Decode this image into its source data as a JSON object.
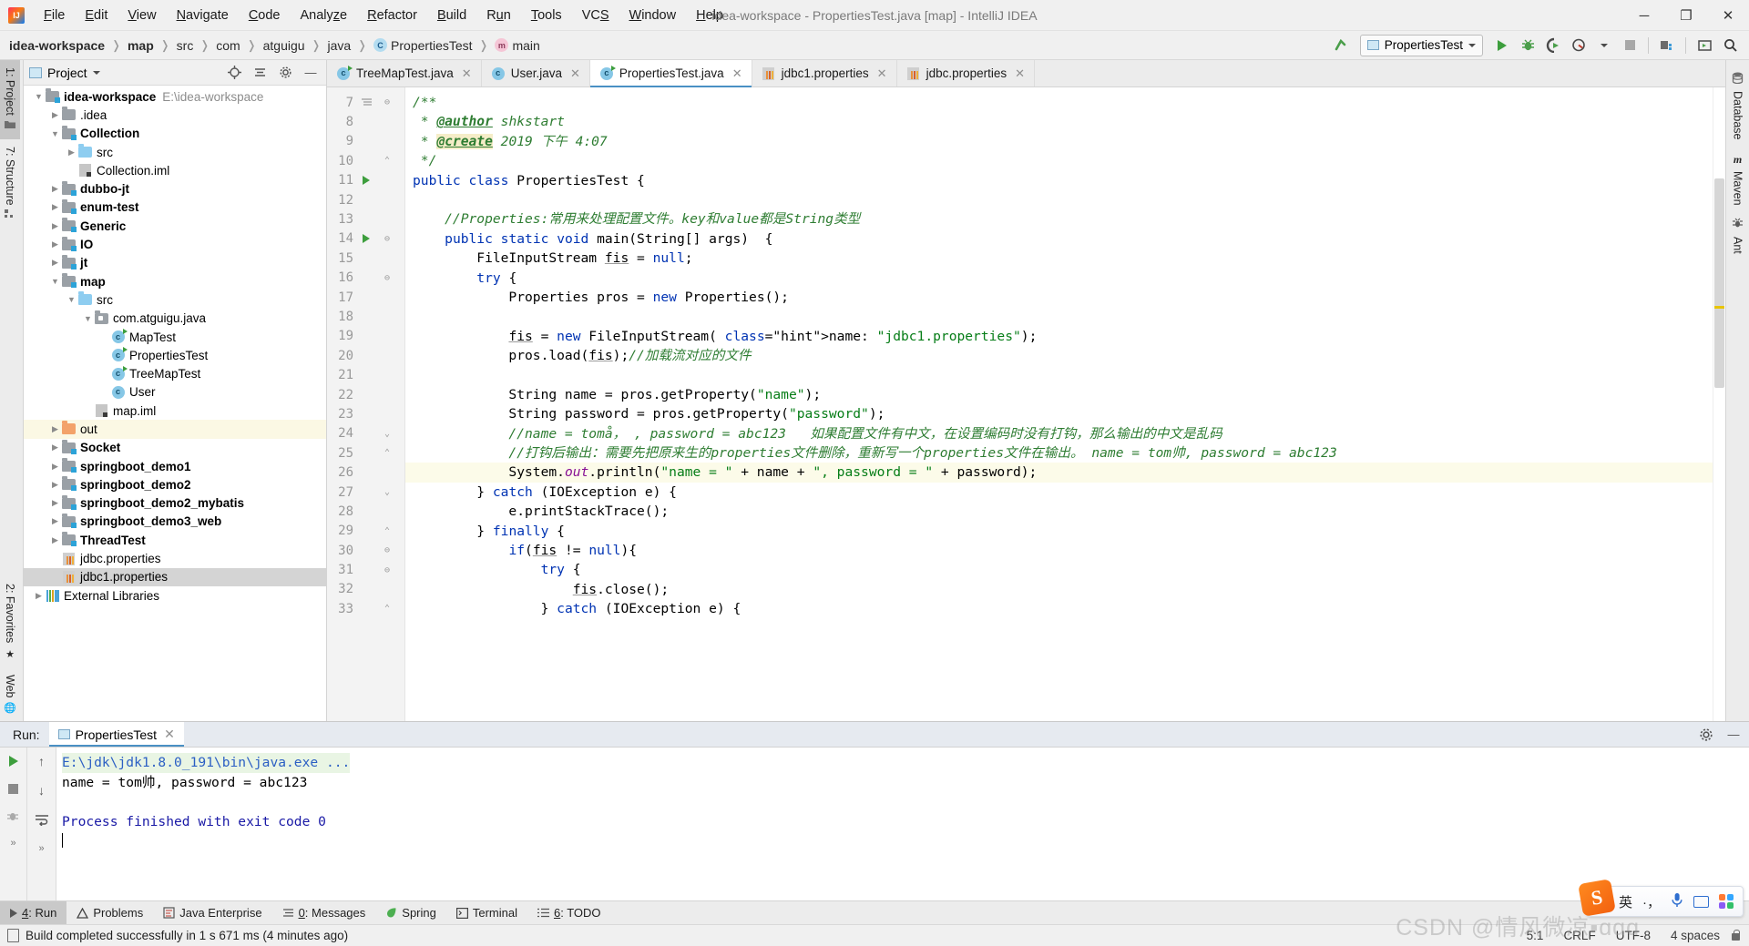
{
  "window": {
    "title": "idea-workspace - PropertiesTest.java [map] - IntelliJ IDEA",
    "minimize": "─",
    "maximize": "❐",
    "close": "✕"
  },
  "menu": [
    {
      "label": "File"
    },
    {
      "label": "Edit"
    },
    {
      "label": "View"
    },
    {
      "label": "Navigate"
    },
    {
      "label": "Code"
    },
    {
      "label": "Analyze"
    },
    {
      "label": "Refactor"
    },
    {
      "label": "Build"
    },
    {
      "label": "Run"
    },
    {
      "label": "Tools"
    },
    {
      "label": "VCS"
    },
    {
      "label": "Window"
    },
    {
      "label": "Help"
    }
  ],
  "breadcrumb": [
    {
      "label": "idea-workspace",
      "bold": true,
      "icon": ""
    },
    {
      "label": "map",
      "bold": true,
      "icon": ""
    },
    {
      "label": "src",
      "bold": false,
      "icon": ""
    },
    {
      "label": "com",
      "bold": false,
      "icon": ""
    },
    {
      "label": "atguigu",
      "bold": false,
      "icon": ""
    },
    {
      "label": "java",
      "bold": false,
      "icon": ""
    },
    {
      "label": "PropertiesTest",
      "bold": false,
      "icon": "class-icon"
    },
    {
      "label": "main",
      "bold": false,
      "icon": "method-icon"
    }
  ],
  "toolbar": {
    "run_configuration": "PropertiesTest",
    "buttons": [
      {
        "name": "update-project-icon"
      },
      {
        "name": "run-icon"
      },
      {
        "name": "debug-icon"
      },
      {
        "name": "run-with-coverage-icon"
      },
      {
        "name": "profiler-icon"
      },
      {
        "name": "stop-icon"
      },
      {
        "name": "project-structure-icon"
      },
      {
        "name": "select-opened-file-icon"
      },
      {
        "name": "search-everywhere-icon"
      }
    ]
  },
  "left_strip": [
    {
      "label": "1: Project",
      "active": true,
      "icon": "folder-icon"
    },
    {
      "label": "7: Structure",
      "active": false,
      "icon": "structure-icon"
    }
  ],
  "left_strip_bottom": [
    {
      "label": "2: Favorites",
      "icon": "star-icon"
    },
    {
      "label": "Web",
      "icon": "globe-icon"
    }
  ],
  "right_strip": [
    {
      "label": "Database",
      "icon": "database-icon"
    },
    {
      "label": "Maven",
      "icon": "maven-icon"
    },
    {
      "label": "Ant",
      "icon": "ant-icon"
    }
  ],
  "project_panel": {
    "title": "Project",
    "header_buttons": [
      {
        "name": "locate-icon"
      },
      {
        "name": "collapse-all-icon"
      },
      {
        "name": "settings-gear-icon"
      },
      {
        "name": "hide-icon"
      }
    ],
    "tree": [
      {
        "indent": 0,
        "arrow": "down",
        "icon": "module-folder",
        "label": "idea-workspace",
        "bold": true,
        "path": "E:\\idea-workspace"
      },
      {
        "indent": 1,
        "arrow": "right",
        "icon": "folder",
        "label": ".idea",
        "bold": false
      },
      {
        "indent": 1,
        "arrow": "down",
        "icon": "module-folder",
        "label": "Collection",
        "bold": true
      },
      {
        "indent": 2,
        "arrow": "right",
        "icon": "src-folder",
        "label": "src",
        "bold": false
      },
      {
        "indent": 2,
        "arrow": "none",
        "icon": "iml",
        "label": "Collection.iml",
        "bold": false
      },
      {
        "indent": 1,
        "arrow": "right",
        "icon": "module-folder",
        "label": "dubbo-jt",
        "bold": true
      },
      {
        "indent": 1,
        "arrow": "right",
        "icon": "module-folder",
        "label": "enum-test",
        "bold": true
      },
      {
        "indent": 1,
        "arrow": "right",
        "icon": "module-folder",
        "label": "Generic",
        "bold": true
      },
      {
        "indent": 1,
        "arrow": "right",
        "icon": "module-folder",
        "label": "IO",
        "bold": true
      },
      {
        "indent": 1,
        "arrow": "right",
        "icon": "module-folder",
        "label": "jt",
        "bold": true
      },
      {
        "indent": 1,
        "arrow": "down",
        "icon": "module-folder",
        "label": "map",
        "bold": true
      },
      {
        "indent": 2,
        "arrow": "down",
        "icon": "src-folder",
        "label": "src",
        "bold": false
      },
      {
        "indent": 3,
        "arrow": "down",
        "icon": "package",
        "label": "com.atguigu.java",
        "bold": false
      },
      {
        "indent": 4,
        "arrow": "none",
        "icon": "class-runnable",
        "label": "MapTest",
        "bold": false
      },
      {
        "indent": 4,
        "arrow": "none",
        "icon": "class-runnable",
        "label": "PropertiesTest",
        "bold": false
      },
      {
        "indent": 4,
        "arrow": "none",
        "icon": "class-runnable",
        "label": "TreeMapTest",
        "bold": false
      },
      {
        "indent": 4,
        "arrow": "none",
        "icon": "class",
        "label": "User",
        "bold": false
      },
      {
        "indent": 3,
        "arrow": "none",
        "icon": "iml",
        "label": "map.iml",
        "bold": false
      },
      {
        "indent": 1,
        "arrow": "right",
        "icon": "out-folder",
        "label": "out",
        "bold": false,
        "highlight": true
      },
      {
        "indent": 1,
        "arrow": "right",
        "icon": "module-folder",
        "label": "Socket",
        "bold": true
      },
      {
        "indent": 1,
        "arrow": "right",
        "icon": "module-folder",
        "label": "springboot_demo1",
        "bold": true
      },
      {
        "indent": 1,
        "arrow": "right",
        "icon": "module-folder",
        "label": "springboot_demo2",
        "bold": true
      },
      {
        "indent": 1,
        "arrow": "right",
        "icon": "module-folder",
        "label": "springboot_demo2_mybatis",
        "bold": true
      },
      {
        "indent": 1,
        "arrow": "right",
        "icon": "module-folder",
        "label": "springboot_demo3_web",
        "bold": true
      },
      {
        "indent": 1,
        "arrow": "right",
        "icon": "module-folder",
        "label": "ThreadTest",
        "bold": true
      },
      {
        "indent": 1,
        "arrow": "none",
        "icon": "properties",
        "label": "jdbc.properties",
        "bold": false
      },
      {
        "indent": 1,
        "arrow": "none",
        "icon": "properties",
        "label": "jdbc1.properties",
        "bold": false,
        "selected": true
      },
      {
        "indent": 0,
        "arrow": "right",
        "icon": "libraries",
        "label": "External Libraries",
        "bold": false
      }
    ]
  },
  "editor_tabs": [
    {
      "label": "TreeMapTest.java",
      "icon": "class-runnable-icon",
      "active": false
    },
    {
      "label": "User.java",
      "icon": "class-icon",
      "active": false
    },
    {
      "label": "PropertiesTest.java",
      "icon": "class-runnable-icon",
      "active": true
    },
    {
      "label": "jdbc1.properties",
      "icon": "properties-icon",
      "active": false
    },
    {
      "label": "jdbc.properties",
      "icon": "properties-icon",
      "active": false
    }
  ],
  "code": {
    "first_line_number": 7,
    "lines": [
      {
        "n": 7,
        "mark": "none",
        "fold": "start",
        "text": "/**"
      },
      {
        "n": 8,
        "mark": "none",
        "fold": "none",
        "text": " * @author shkstart"
      },
      {
        "n": 9,
        "mark": "none",
        "fold": "none",
        "text": " * @create 2019 下午 4:07"
      },
      {
        "n": 10,
        "mark": "none",
        "fold": "end",
        "text": " */"
      },
      {
        "n": 11,
        "mark": "run",
        "fold": "none",
        "text": "public class PropertiesTest {"
      },
      {
        "n": 12,
        "mark": "none",
        "fold": "none",
        "text": ""
      },
      {
        "n": 13,
        "mark": "none",
        "fold": "none",
        "text": "    //Properties:常用来处理配置文件。key和value都是String类型"
      },
      {
        "n": 14,
        "mark": "run",
        "fold": "start",
        "text": "    public static void main(String[] args)  {"
      },
      {
        "n": 15,
        "mark": "none",
        "fold": "none",
        "text": "        FileInputStream fis = null;"
      },
      {
        "n": 16,
        "mark": "none",
        "fold": "start",
        "text": "        try {"
      },
      {
        "n": 17,
        "mark": "none",
        "fold": "none",
        "text": "            Properties pros = new Properties();"
      },
      {
        "n": 18,
        "mark": "none",
        "fold": "none",
        "text": ""
      },
      {
        "n": 19,
        "mark": "none",
        "fold": "none",
        "text": "            fis = new FileInputStream( name: \"jdbc1.properties\");"
      },
      {
        "n": 20,
        "mark": "none",
        "fold": "none",
        "text": "            pros.load(fis);//加载流对应的文件"
      },
      {
        "n": 21,
        "mark": "none",
        "fold": "none",
        "text": ""
      },
      {
        "n": 22,
        "mark": "none",
        "fold": "none",
        "text": "            String name = pros.getProperty(\"name\");"
      },
      {
        "n": 23,
        "mark": "none",
        "fold": "none",
        "text": "            String password = pros.getProperty(\"password\");"
      },
      {
        "n": 24,
        "mark": "none",
        "fold": "mid",
        "text": "            //name = tomå， , password = abc123   如果配置文件有中文，在设置编码时没有打钩，那么输出的中文是乱码"
      },
      {
        "n": 25,
        "mark": "none",
        "fold": "end",
        "text": "            //打钩后输出：需要先把原来生的properties文件删除，重新写一个properties文件在输出。 name = tom帅, password = abc123"
      },
      {
        "n": 26,
        "mark": "none",
        "fold": "none",
        "text": "            System.out.println(\"name = \" + name + \", password = \" + password);"
      },
      {
        "n": 27,
        "mark": "none",
        "fold": "mid",
        "text": "        } catch (IOException e) {"
      },
      {
        "n": 28,
        "mark": "none",
        "fold": "none",
        "text": "            e.printStackTrace();"
      },
      {
        "n": 29,
        "mark": "none",
        "fold": "end",
        "text": "        } finally {"
      },
      {
        "n": 30,
        "mark": "none",
        "fold": "start",
        "text": "            if(fis != null){"
      },
      {
        "n": 31,
        "mark": "none",
        "fold": "start",
        "text": "                try {"
      },
      {
        "n": 32,
        "mark": "none",
        "fold": "none",
        "text": "                    fis.close();"
      },
      {
        "n": 33,
        "mark": "none",
        "fold": "end",
        "text": "                } catch (IOException e) {"
      }
    ]
  },
  "run_panel": {
    "label": "Run:",
    "tab": "PropertiesTest",
    "header_buttons": [
      {
        "name": "settings-gear-icon"
      },
      {
        "name": "hide-icon"
      }
    ],
    "tool_buttons": [
      {
        "name": "rerun-icon"
      },
      {
        "name": "stop-icon"
      },
      {
        "name": "debug-icon"
      },
      {
        "name": "scroll-up-icon"
      },
      {
        "name": "scroll-down-icon"
      },
      {
        "name": "soft-wrap-icon"
      }
    ],
    "console": [
      {
        "text": "E:\\jdk\\jdk1.8.0_191\\bin\\java.exe ...",
        "style": "command"
      },
      {
        "text": "name = tom帅, password = abc123",
        "style": "output"
      },
      {
        "text": "",
        "style": "output"
      },
      {
        "text": "Process finished with exit code 0",
        "style": "final"
      }
    ]
  },
  "bottom_tabs": [
    {
      "label": "4: Run",
      "icon": "run-icon",
      "active": true
    },
    {
      "label": "Problems",
      "icon": "warning-icon",
      "active": false
    },
    {
      "label": "Java Enterprise",
      "icon": "java-ee-icon",
      "active": false
    },
    {
      "label": "0: Messages",
      "icon": "messages-icon",
      "active": false
    },
    {
      "label": "Spring",
      "icon": "spring-leaf-icon",
      "active": false
    },
    {
      "label": "Terminal",
      "icon": "terminal-icon",
      "active": false
    },
    {
      "label": "6: TODO",
      "icon": "todo-list-icon",
      "active": false
    }
  ],
  "status_bar": {
    "message": "Build completed successfully in 1 s 671 ms (4 minutes ago)",
    "caret_position": "5:1",
    "line_separator": "CRLF",
    "encoding": "UTF-8",
    "indent": "4 spaces",
    "lock_icon": "read-only-lock-icon"
  },
  "watermark": "CSDN @情风微凉▪ɑɑɑ",
  "ime": {
    "logo": "S",
    "mode": "英",
    "punctuation": "·，",
    "mic": "microphone-icon",
    "keyboard": "soft-keyboard-icon",
    "toolbox": "toolbox-icon"
  },
  "colors": {
    "accent": "#4a90c4",
    "run_green": "#3d9e3d",
    "string_green": "#067d17",
    "keyword_blue": "#0033b3",
    "comment_green": "#2e7d32",
    "warning_yellow": "#e8c404"
  }
}
